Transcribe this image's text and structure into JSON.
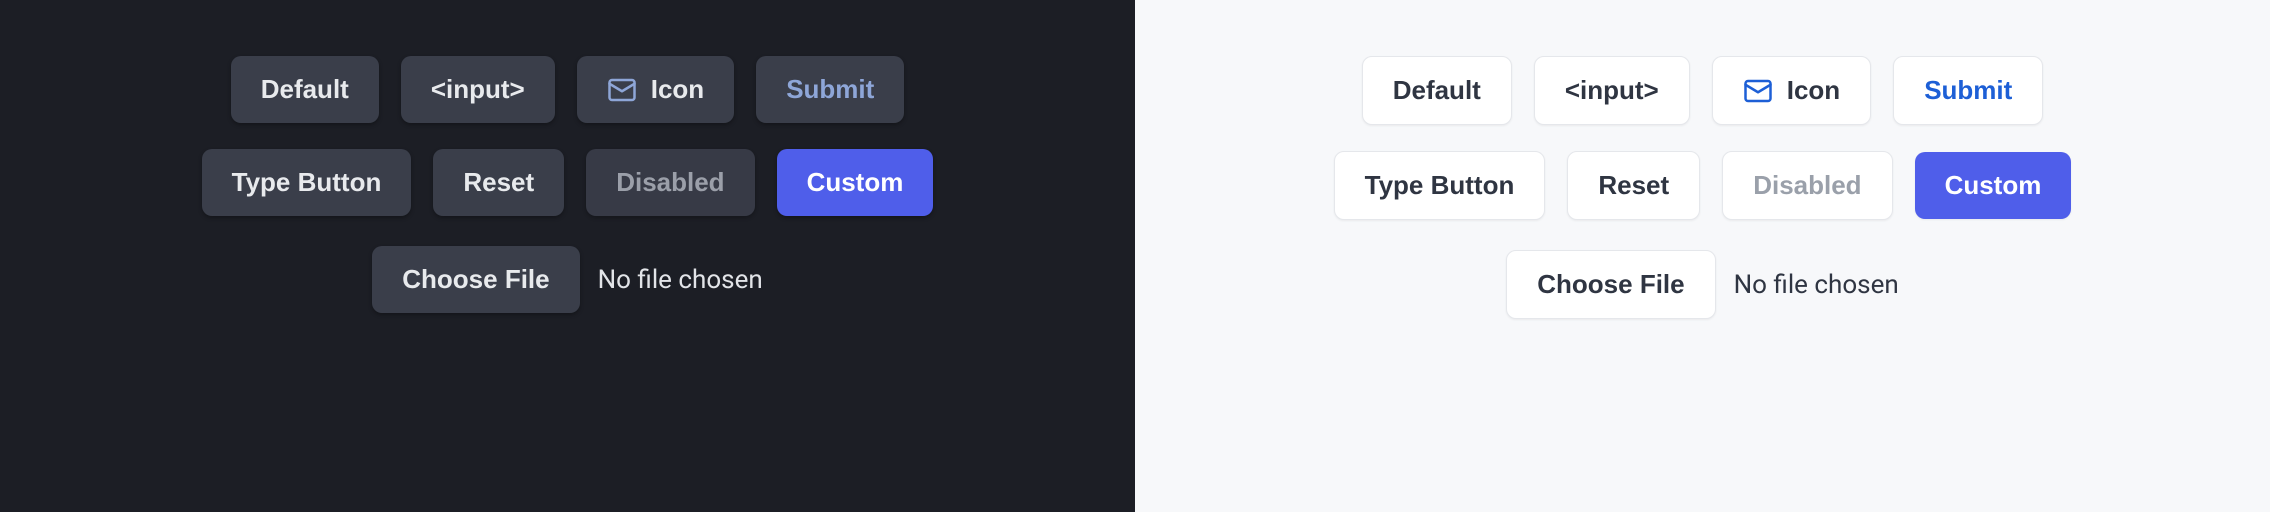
{
  "buttons": {
    "default": "Default",
    "input": "<input>",
    "icon": "Icon",
    "submit": "Submit",
    "type_button": "Type Button",
    "reset": "Reset",
    "disabled": "Disabled",
    "custom": "Custom",
    "choose_file": "Choose File"
  },
  "file": {
    "no_file": "No file chosen"
  },
  "colors": {
    "dark_bg": "#1c1e25",
    "light_bg": "#f7f8fa",
    "dark_btn": "#3a3e4a",
    "light_btn": "#ffffff",
    "primary": "#4f5eea",
    "submit_link_dark": "#8ea6d8",
    "submit_link_light": "#1d5fd6"
  }
}
